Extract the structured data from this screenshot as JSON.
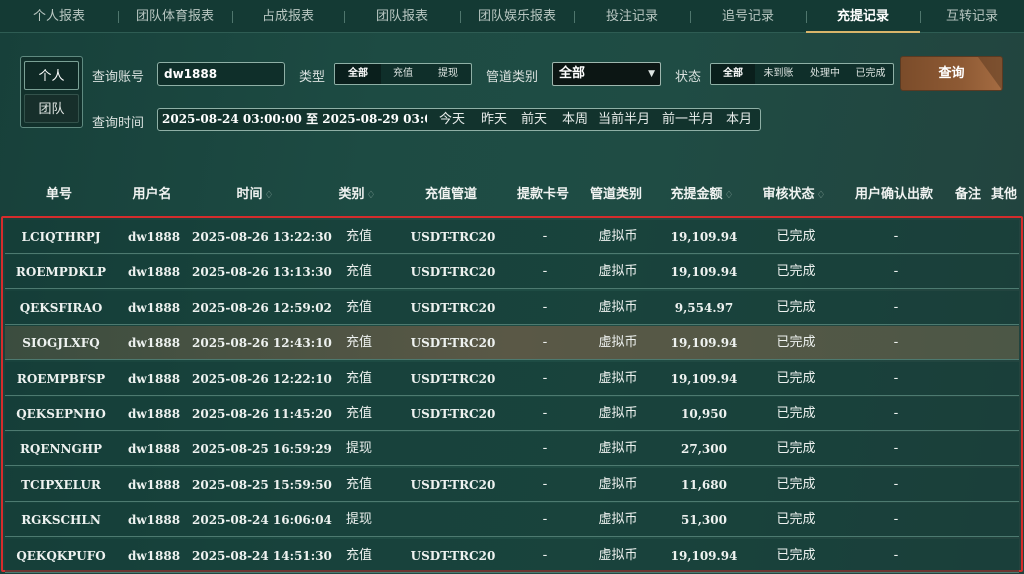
{
  "tabs": [
    {
      "label": "个人报表",
      "active": false
    },
    {
      "label": "团队体育报表",
      "active": false
    },
    {
      "label": "占成报表",
      "active": false
    },
    {
      "label": "团队报表",
      "active": false
    },
    {
      "label": "团队娱乐报表",
      "active": false
    },
    {
      "label": "投注记录",
      "active": false
    },
    {
      "label": "追号记录",
      "active": false
    },
    {
      "label": "充提记录",
      "active": true
    },
    {
      "label": "互转记录",
      "active": false
    }
  ],
  "scope": {
    "personal": "个人",
    "team": "团队",
    "selected": "个人"
  },
  "filters": {
    "account_label": "查询账号",
    "account_value": "dw1888",
    "type_label": "类型",
    "type_options": [
      "全部",
      "充值",
      "提现"
    ],
    "type_selected": "全部",
    "channel_label": "管道类别",
    "channel_value": "全部",
    "status_label": "状态",
    "status_options": [
      "全部",
      "未到账",
      "处理中",
      "已完成"
    ],
    "status_selected": "全部",
    "query_button": "查询",
    "time_label": "查询时间",
    "time_range": "2025-08-24 03:00:00 至 2025-08-29 03:00:0",
    "quick_ranges": [
      "今天",
      "昨天",
      "前天",
      "本周",
      "当前半月",
      "前一半月",
      "本月"
    ]
  },
  "table": {
    "headers": [
      "单号",
      "用户名",
      "时间",
      "类别",
      "充值管道",
      "提款卡号",
      "管道类别",
      "充提金额",
      "审核状态",
      "用户确认出款",
      "备注",
      "其他"
    ],
    "rows": [
      [
        "LCIQTHRPJ",
        "dw1888",
        "2025-08-26 13:22:30",
        "充值",
        "USDT-TRC20",
        "-",
        "虚拟币",
        "19,109.94",
        "已完成",
        "-"
      ],
      [
        "ROEMPDKLP",
        "dw1888",
        "2025-08-26 13:13:30",
        "充值",
        "USDT-TRC20",
        "-",
        "虚拟币",
        "19,109.94",
        "已完成",
        "-"
      ],
      [
        "QEKSFIRAO",
        "dw1888",
        "2025-08-26 12:59:02",
        "充值",
        "USDT-TRC20",
        "-",
        "虚拟币",
        "9,554.97",
        "已完成",
        "-"
      ],
      [
        "SIOGJLXFQ",
        "dw1888",
        "2025-08-26 12:43:10",
        "充值",
        "USDT-TRC20",
        "-",
        "虚拟币",
        "19,109.94",
        "已完成",
        "-"
      ],
      [
        "ROEMPBFSP",
        "dw1888",
        "2025-08-26 12:22:10",
        "充值",
        "USDT-TRC20",
        "-",
        "虚拟币",
        "19,109.94",
        "已完成",
        "-"
      ],
      [
        "QEKSEPNHO",
        "dw1888",
        "2025-08-26 11:45:20",
        "充值",
        "USDT-TRC20",
        "-",
        "虚拟币",
        "10,950",
        "已完成",
        "-"
      ],
      [
        "RQENNGHP",
        "dw1888",
        "2025-08-25 16:59:29",
        "提现",
        "",
        "-",
        "虚拟币",
        "27,300",
        "已完成",
        "-"
      ],
      [
        "TCIPXELUR",
        "dw1888",
        "2025-08-25 15:59:50",
        "充值",
        "USDT-TRC20",
        "-",
        "虚拟币",
        "11,680",
        "已完成",
        "-"
      ],
      [
        "RGKSCHLN",
        "dw1888",
        "2025-08-24 16:06:04",
        "提现",
        "",
        "-",
        "虚拟币",
        "51,300",
        "已完成",
        "-"
      ],
      [
        "QEKQKPUFO",
        "dw1888",
        "2025-08-24 14:51:30",
        "充值",
        "USDT-TRC20",
        "-",
        "虚拟币",
        "19,109.94",
        "已完成",
        "-"
      ]
    ],
    "highlighted_row": 3
  },
  "colors": {
    "accent": "#d9b56a",
    "selection_border": "#d62c2c",
    "query_button": "#8e5a34"
  },
  "icons": {
    "sort": "sort-arrows-icon",
    "dropdown": "chevron-down-icon"
  }
}
